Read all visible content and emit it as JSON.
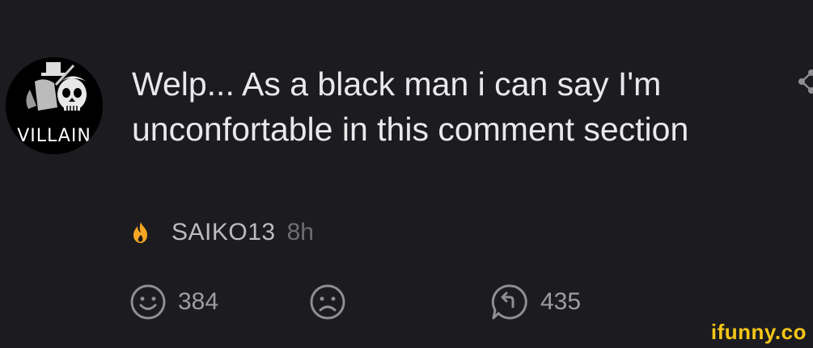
{
  "comment": {
    "text": "Welp... As a black man i can say I'm unconfortable in this comment section",
    "username": "SAIKO13",
    "time": "8h",
    "avatar_icon": "villain-avatar",
    "avatar_text": "VILLAIN",
    "badge_icon": "fire-icon"
  },
  "actions": {
    "smile_count": "384",
    "frown_count": "",
    "reply_count": "435"
  },
  "watermark": {
    "text": "ifunny.co"
  },
  "colors": {
    "background": "#1c1c20",
    "text": "#e9e9ea",
    "muted": "#6d6d72",
    "fire": "#f5a623",
    "watermark": "#f5c518"
  }
}
